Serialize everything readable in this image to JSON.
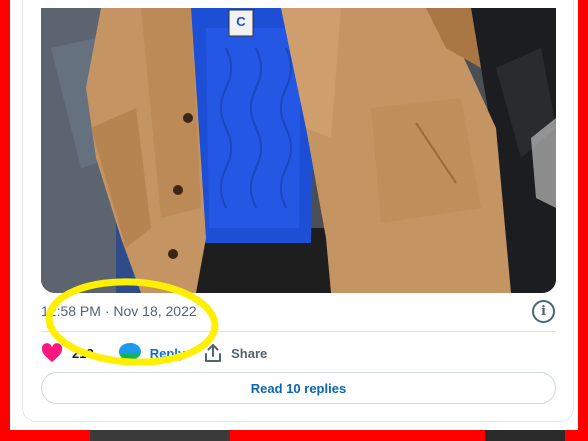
{
  "post": {
    "timestamp": "12:58 PM · Nov 18, 2022",
    "info_icon": "info-icon",
    "badge_text": "C"
  },
  "actions": {
    "like_icon": "heart-icon",
    "like_count": "213",
    "reply_icon": "speech-bubble-icon",
    "reply_label": "Reply",
    "share_icon": "share-icon",
    "share_label": "Share"
  },
  "read_replies": {
    "label": "Read 10 replies"
  },
  "colors": {
    "frame": "#ff0000",
    "heart": "#f91880",
    "link": "#0b63b6",
    "annotation": "#ffef00"
  }
}
